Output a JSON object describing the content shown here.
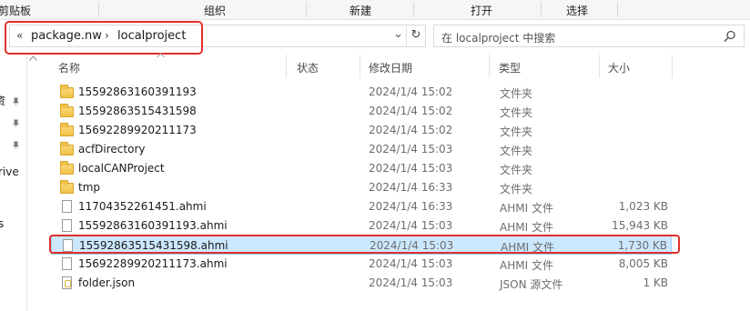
{
  "ribbon": {
    "groups": [
      "剪贴板",
      "组织",
      "新建",
      "打开",
      "选择"
    ]
  },
  "address": {
    "back_glyph": "«",
    "crumbs": [
      "package.nw",
      "localproject"
    ],
    "chevron": "›",
    "dropdown_glyph": "⌄",
    "refresh_glyph": "↻"
  },
  "search": {
    "placeholder": "在 localproject 中搜索",
    "icon": "search-icon"
  },
  "nav": {
    "items": [
      "资",
      "",
      "",
      "rive",
      "s"
    ]
  },
  "columns": {
    "name": "名称",
    "status": "状态",
    "modified": "修改日期",
    "type": "类型",
    "size": "大小"
  },
  "files": [
    {
      "name": "15592863160391193",
      "date": "2024/1/4 15:02",
      "type": "文件夹",
      "size": "",
      "icon": "folder-icon"
    },
    {
      "name": "15592863515431598",
      "date": "2024/1/4 15:02",
      "type": "文件夹",
      "size": "",
      "icon": "folder-icon"
    },
    {
      "name": "15692289920211173",
      "date": "2024/1/4 15:02",
      "type": "文件夹",
      "size": "",
      "icon": "folder-icon"
    },
    {
      "name": "acfDirectory",
      "date": "2024/1/4 15:03",
      "type": "文件夹",
      "size": "",
      "icon": "folder-icon"
    },
    {
      "name": "localCANProject",
      "date": "2024/1/4 15:03",
      "type": "文件夹",
      "size": "",
      "icon": "folder-icon"
    },
    {
      "name": "tmp",
      "date": "2024/1/4 16:33",
      "type": "文件夹",
      "size": "",
      "icon": "folder-icon"
    },
    {
      "name": "11704352261451.ahmi",
      "date": "2024/1/4 16:33",
      "type": "AHMI 文件",
      "size": "1,023 KB",
      "icon": "file-icon"
    },
    {
      "name": "15592863160391193.ahmi",
      "date": "2024/1/4 15:03",
      "type": "AHMI 文件",
      "size": "15,943 KB",
      "icon": "file-icon"
    },
    {
      "name": "15592863515431598.ahmi",
      "date": "2024/1/4 15:03",
      "type": "AHMI 文件",
      "size": "1,730 KB",
      "icon": "file-icon",
      "selected": true
    },
    {
      "name": "15692289920211173.ahmi",
      "date": "2024/1/4 15:03",
      "type": "AHMI 文件",
      "size": "8,005 KB",
      "icon": "file-icon"
    },
    {
      "name": "folder.json",
      "date": "2024/1/4 15:03",
      "type": "JSON 源文件",
      "size": "1 KB",
      "icon": "json-file-icon"
    }
  ],
  "colors": {
    "highlight_box": "#e0302a",
    "selection_bg": "#cce8ff",
    "folder": "#f1c24a"
  }
}
